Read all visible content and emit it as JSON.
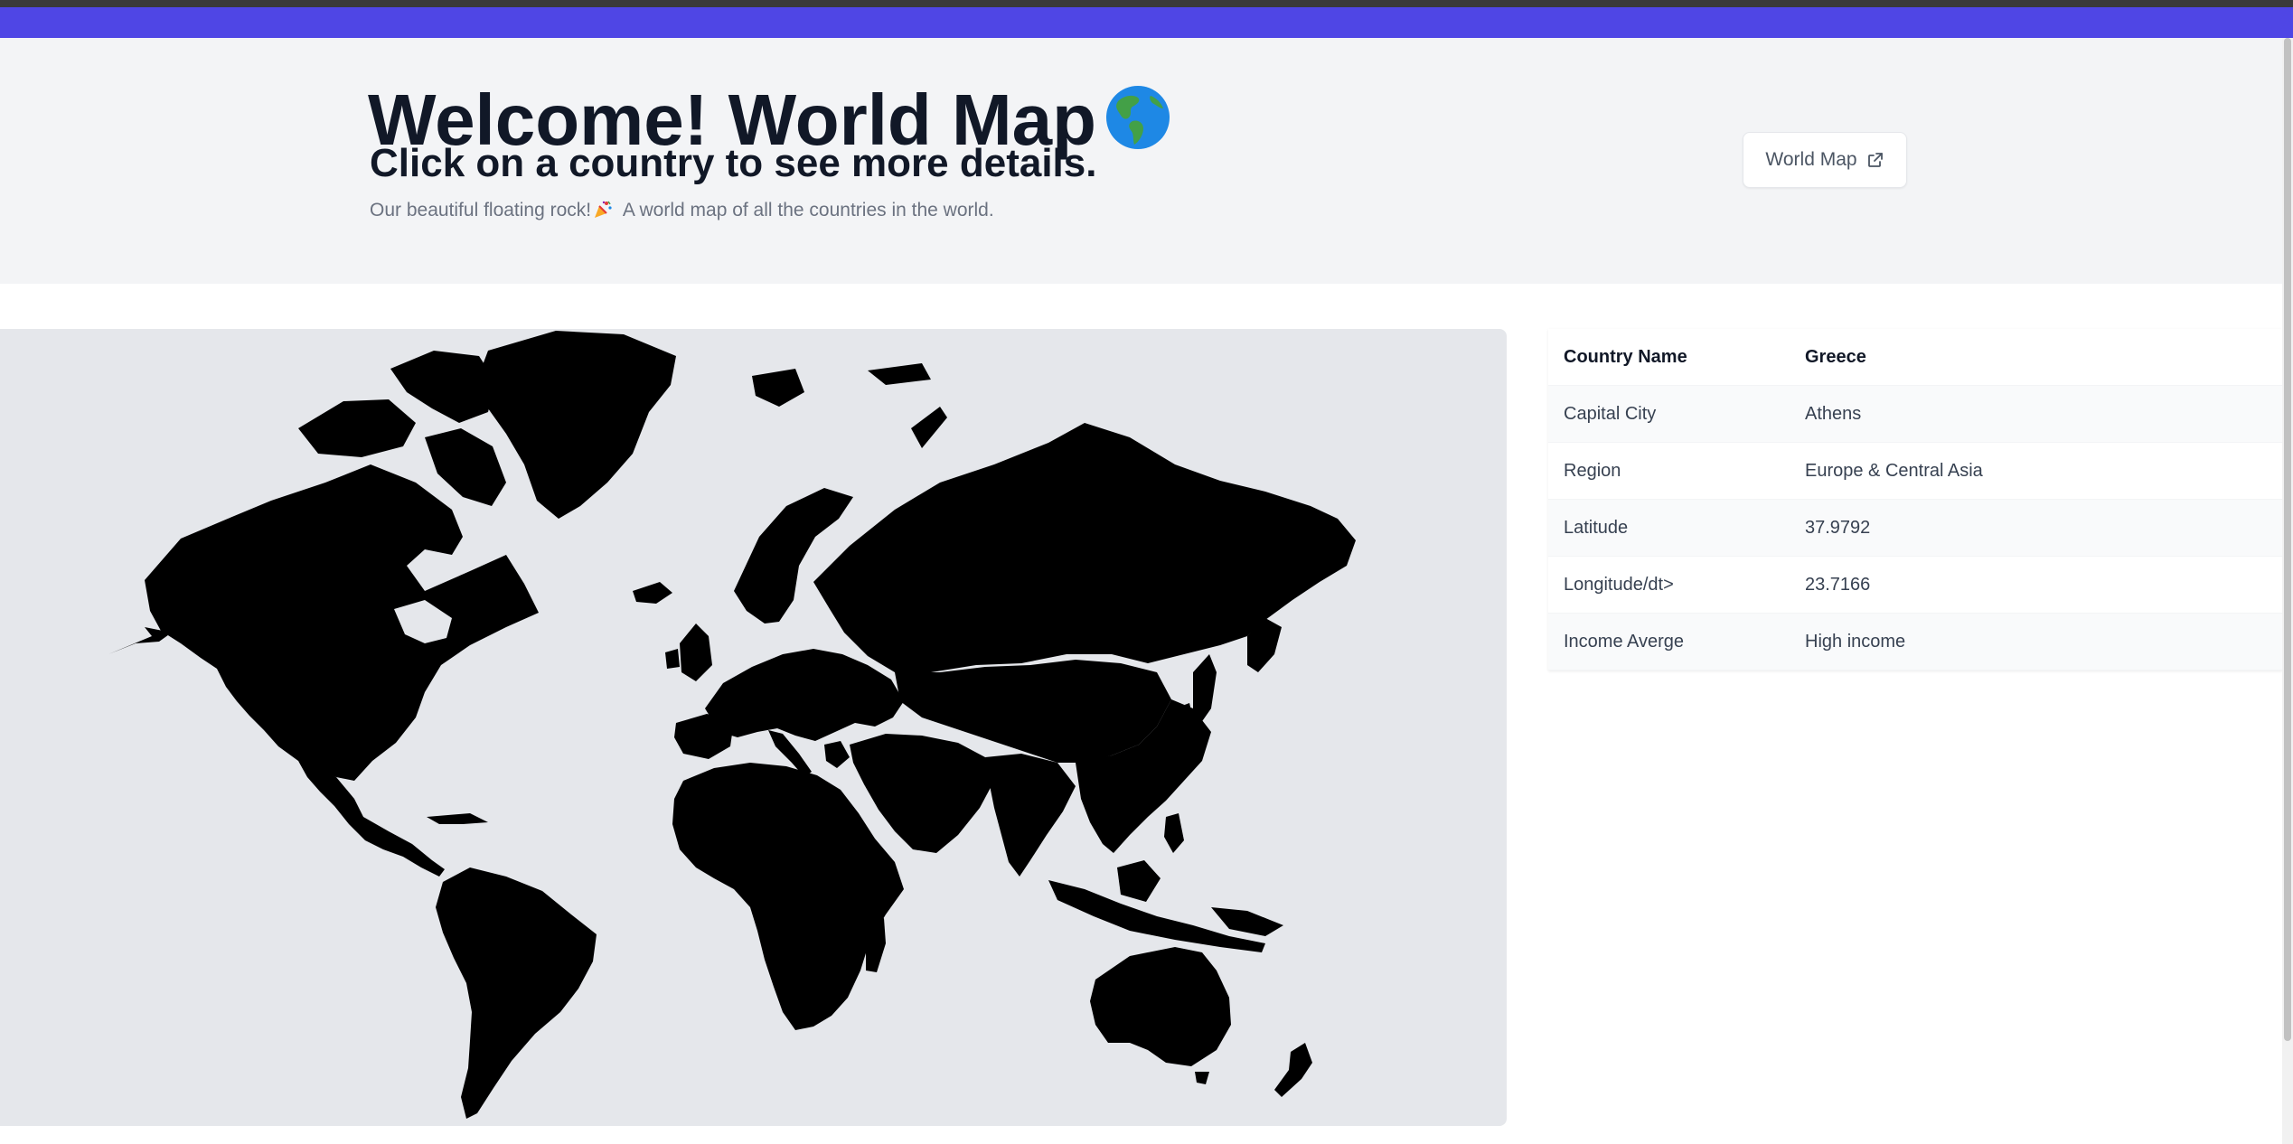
{
  "header": {
    "title": "Welcome! World Map",
    "subtitle": "Click on a country to see more details.",
    "description_before": "Our beautiful floating rock!",
    "description_after": " A world map of all the countries in the world.",
    "link_button": "World Map"
  },
  "icons": {
    "title_icon": "globe-americas-emoji",
    "description_icon": "party-popper-emoji",
    "button_icon": "external-link-icon"
  },
  "details": {
    "header": {
      "label": "Country Name",
      "value": "Greece"
    },
    "rows": [
      {
        "label": "Capital City",
        "value": "Athens"
      },
      {
        "label": "Region",
        "value": "Europe & Central Asia"
      },
      {
        "label": "Latitude",
        "value": "37.9792"
      },
      {
        "label": "Longitude/dt>",
        "value": "23.7166"
      },
      {
        "label": "Income Averge",
        "value": "High income"
      }
    ]
  },
  "map": {
    "selected_country": "Greece"
  },
  "colors": {
    "accent": "#4f46e5",
    "header_bg": "#f3f4f6",
    "map_bg": "#e5e7eb",
    "land": "#000000",
    "title_text": "#111827"
  }
}
